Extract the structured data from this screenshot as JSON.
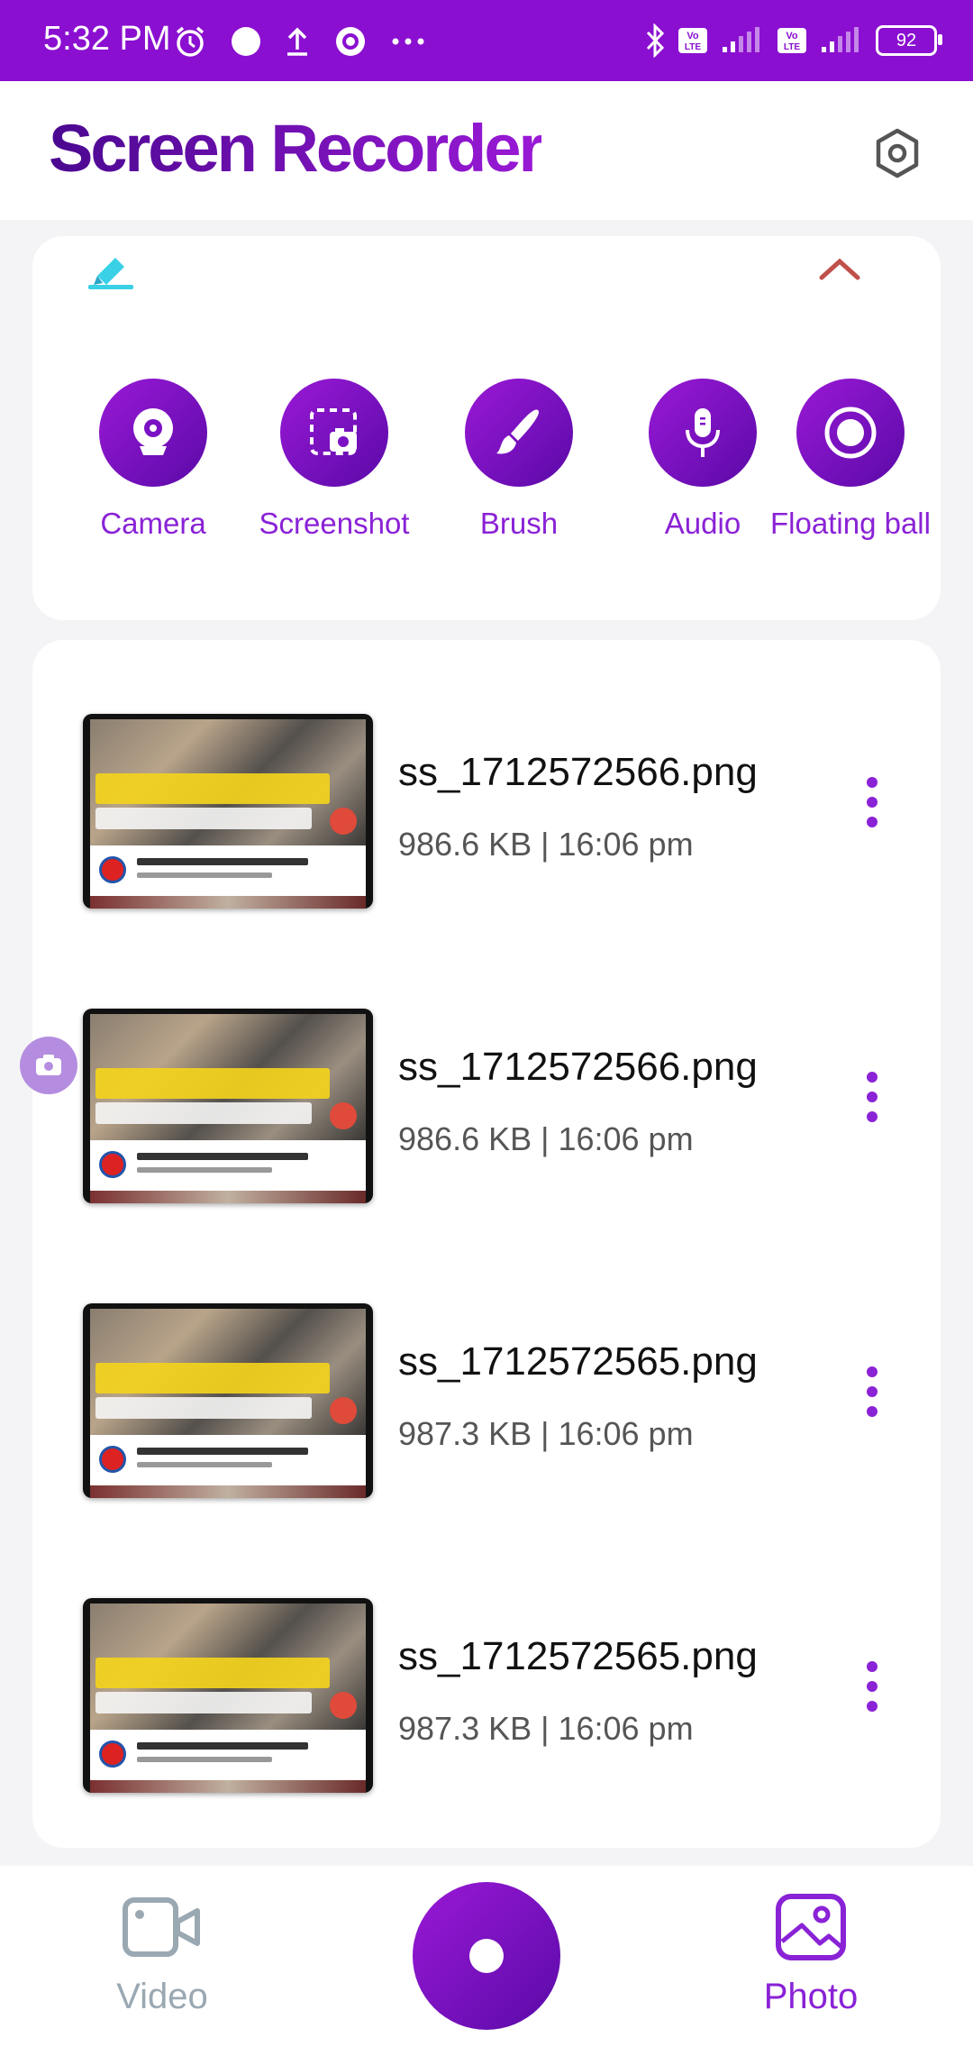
{
  "status_bar": {
    "time": "5:32 PM",
    "battery": "92",
    "icons": [
      "alarm-icon",
      "circle-icon",
      "upload-icon",
      "record-ring-icon",
      "more-dots-icon",
      "bluetooth-icon",
      "volte-icon",
      "signal-icon",
      "volte-icon",
      "signal-icon",
      "battery-icon"
    ]
  },
  "header": {
    "title": "Screen Recorder"
  },
  "tools": [
    {
      "label": "Camera",
      "icon": "webcam-icon"
    },
    {
      "label": "Screenshot",
      "icon": "screenshot-icon"
    },
    {
      "label": "Brush",
      "icon": "brush-icon"
    },
    {
      "label": "Audio",
      "icon": "microphone-icon"
    },
    {
      "label": "Floating ball",
      "icon": "floating-ball-icon"
    }
  ],
  "files": [
    {
      "name": "ss_1712572566.png",
      "meta": "986.6 KB | 16:06 pm"
    },
    {
      "name": "ss_1712572566.png",
      "meta": "986.6 KB | 16:06 pm"
    },
    {
      "name": "ss_1712572565.png",
      "meta": "987.3 KB | 16:06 pm"
    },
    {
      "name": "ss_1712572565.png",
      "meta": "987.3 KB | 16:06 pm"
    }
  ],
  "bottom_nav": {
    "video_label": "Video",
    "photo_label": "Photo",
    "active": "Photo"
  },
  "colors": {
    "accent": "#8a0fd0",
    "accent_dark": "#5a0aa8",
    "inactive_nav": "#9aa8b2",
    "collapse_arrow": "#c0504a"
  }
}
